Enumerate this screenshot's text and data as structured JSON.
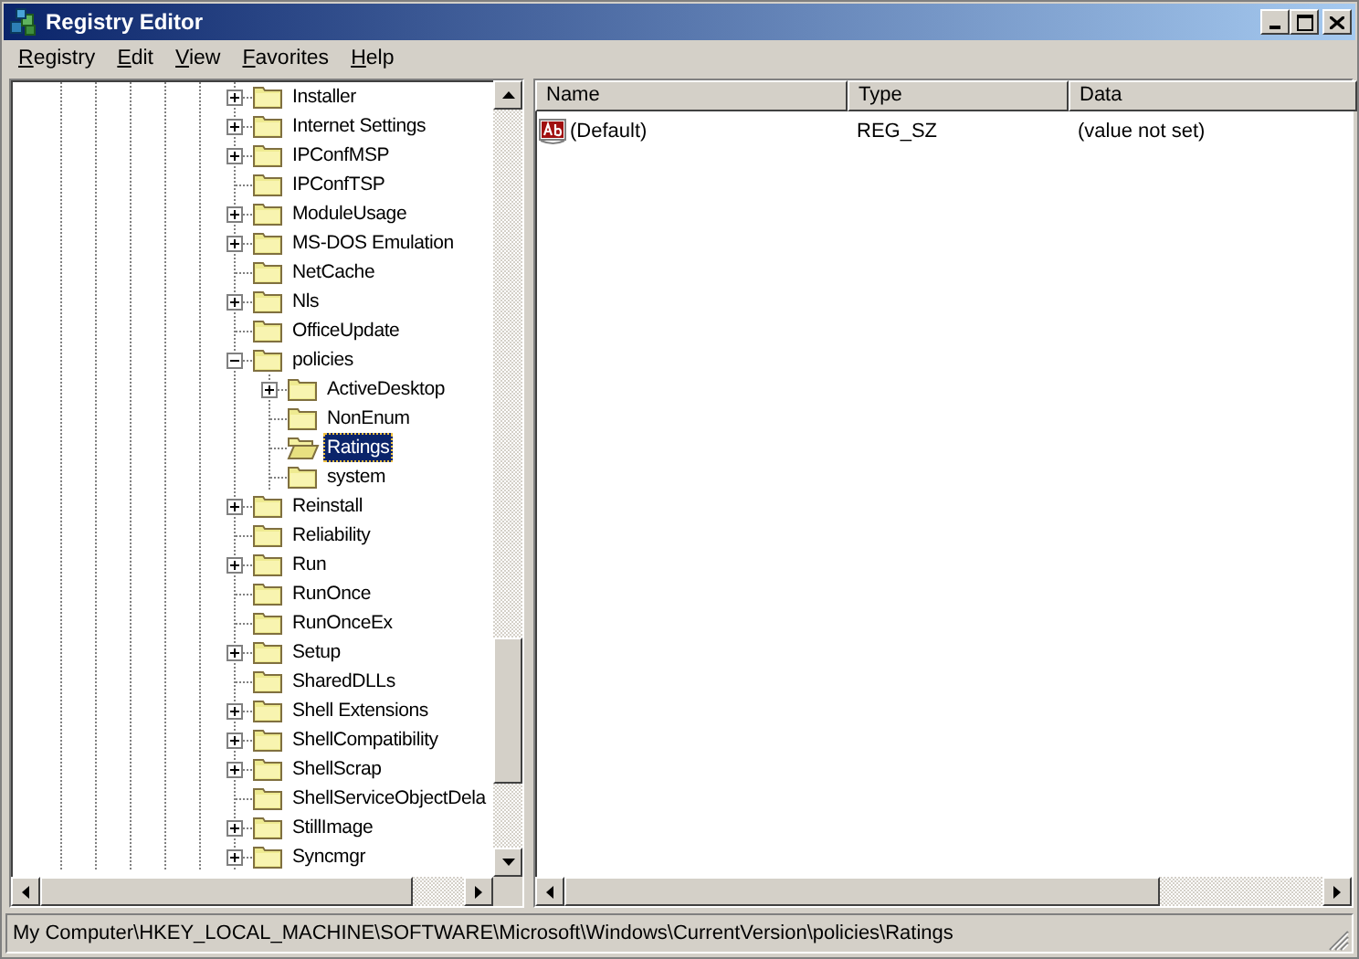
{
  "window": {
    "title": "Registry Editor"
  },
  "menu": [
    {
      "label": "Registry"
    },
    {
      "label": "Edit"
    },
    {
      "label": "View"
    },
    {
      "label": "Favorites"
    },
    {
      "label": "Help"
    }
  ],
  "tree": {
    "items": [
      {
        "label": "Installer",
        "expanded": false,
        "selected": false
      },
      {
        "label": "Internet Settings",
        "expanded": false,
        "selected": false
      },
      {
        "label": "IPConfMSP",
        "expanded": false,
        "selected": false
      },
      {
        "label": "IPConfTSP",
        "selected": false
      },
      {
        "label": "ModuleUsage",
        "expanded": false,
        "selected": false
      },
      {
        "label": "MS-DOS Emulation",
        "expanded": false,
        "selected": false
      },
      {
        "label": "NetCache",
        "selected": false
      },
      {
        "label": "Nls",
        "expanded": false,
        "selected": false
      },
      {
        "label": "OfficeUpdate",
        "selected": false
      },
      {
        "label": "policies",
        "expanded": true,
        "selected": false,
        "children": [
          {
            "label": "ActiveDesktop",
            "expanded": false,
            "selected": false
          },
          {
            "label": "NonEnum",
            "selected": false
          },
          {
            "label": "Ratings",
            "selected": true
          },
          {
            "label": "system",
            "selected": false
          }
        ]
      },
      {
        "label": "Reinstall",
        "expanded": false,
        "selected": false
      },
      {
        "label": "Reliability",
        "selected": false
      },
      {
        "label": "Run",
        "expanded": false,
        "selected": false
      },
      {
        "label": "RunOnce",
        "selected": false
      },
      {
        "label": "RunOnceEx",
        "selected": false
      },
      {
        "label": "Setup",
        "expanded": false,
        "selected": false
      },
      {
        "label": "SharedDLLs",
        "selected": false
      },
      {
        "label": "Shell Extensions",
        "expanded": false,
        "selected": false
      },
      {
        "label": "ShellCompatibility",
        "expanded": false,
        "selected": false
      },
      {
        "label": "ShellScrap",
        "expanded": false,
        "selected": false
      },
      {
        "label": "ShellServiceObjectDela",
        "selected": false
      },
      {
        "label": "StillImage",
        "expanded": false,
        "selected": false
      },
      {
        "label": "Syncmgr",
        "expanded": false,
        "selected": false
      }
    ]
  },
  "list": {
    "columns": [
      {
        "label": "Name"
      },
      {
        "label": "Type"
      },
      {
        "label": "Data"
      }
    ],
    "rows": [
      {
        "kind": "string",
        "name": "(Default)",
        "type": "REG_SZ",
        "data": "(value not set)"
      }
    ]
  },
  "status_bar": "My Computer\\HKEY_LOCAL_MACHINE\\SOFTWARE\\Microsoft\\Windows\\CurrentVersion\\policies\\Ratings"
}
